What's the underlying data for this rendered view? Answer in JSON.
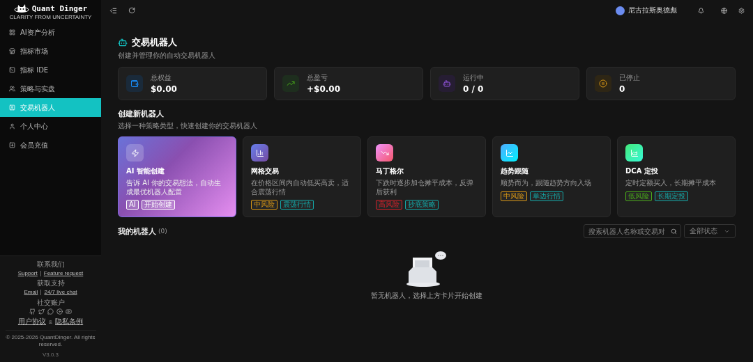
{
  "logo": {
    "name": "Quant Dinger",
    "tagline": "CLARITY FROM UNCERTAINTY"
  },
  "sidebar": {
    "items": [
      {
        "label": "AI资产分析",
        "selected": false
      },
      {
        "label": "指标市场",
        "selected": false
      },
      {
        "label": "指标 IDE",
        "selected": false
      },
      {
        "label": "策略与实盘",
        "selected": false
      },
      {
        "label": "交易机器人",
        "selected": true
      },
      {
        "label": "个人中心",
        "selected": false
      },
      {
        "label": "会员充值",
        "selected": false
      }
    ]
  },
  "footer": {
    "contact_title": "联系我们",
    "contact_links": [
      "Support",
      "Feature request"
    ],
    "support_title": "获取支持",
    "support_links": [
      "Email",
      "24/7 live chat"
    ],
    "social_title": "社交账户",
    "legal_links": [
      "用户协议",
      "隐私条例"
    ],
    "legal_separator": "&",
    "copyright": "© 2025-2026 QuantDinger. All rights reserved.",
    "version": "V3.0.3"
  },
  "header": {
    "user": "尼古拉斯奥德彪"
  },
  "page": {
    "title": "交易机器人",
    "subtitle": "创建并管理你的自动交易机器人"
  },
  "stats": [
    {
      "label": "总权益",
      "value": "$0.00"
    },
    {
      "label": "总盈亏",
      "value": "+$0.00"
    },
    {
      "label": "运行中",
      "value": "0 / 0"
    },
    {
      "label": "已停止",
      "value": "0"
    }
  ],
  "create": {
    "title": "创建新机器人",
    "subtitle": "选择一种策略类型，快速创建你的交易机器人",
    "cards": [
      {
        "title": "AI 智能创建",
        "description": "告诉 AI 你的交易想法，自动生成最优机器人配置",
        "featured": true,
        "tags": [
          {
            "label": "AI",
            "color": "#ffffff"
          },
          {
            "label": "开始创建",
            "color": "#ffffff"
          }
        ]
      },
      {
        "title": "网格交易",
        "description": "在价格区间内自动低买高卖，适合震荡行情",
        "featured": false,
        "tags": [
          {
            "label": "中风险",
            "color": "#d89614"
          },
          {
            "label": "震荡行情",
            "color": "#13a8a8"
          }
        ]
      },
      {
        "title": "马丁格尔",
        "description": "下跌时逐步加仓摊平成本，反弹后获利",
        "featured": false,
        "tags": [
          {
            "label": "高风险",
            "color": "#d32029"
          },
          {
            "label": "抄底策略",
            "color": "#13a8a8"
          }
        ]
      },
      {
        "title": "趋势跟随",
        "description": "顺势而为，跟随趋势方向入场",
        "featured": false,
        "tags": [
          {
            "label": "中风险",
            "color": "#d89614"
          },
          {
            "label": "单边行情",
            "color": "#13a8a8"
          }
        ]
      },
      {
        "title": "DCA 定投",
        "description": "定时定额买入，长期摊平成本",
        "featured": false,
        "tags": [
          {
            "label": "低风险",
            "color": "#49aa19"
          },
          {
            "label": "长期定投",
            "color": "#13a8a8"
          }
        ]
      }
    ]
  },
  "robots": {
    "title": "我的机器人",
    "count": "(0)",
    "search": {
      "placeholder": "搜索机器人名称或交易对"
    },
    "status_filter": "全部状态",
    "empty": "暂无机器人，选择上方卡片开始创建"
  }
}
